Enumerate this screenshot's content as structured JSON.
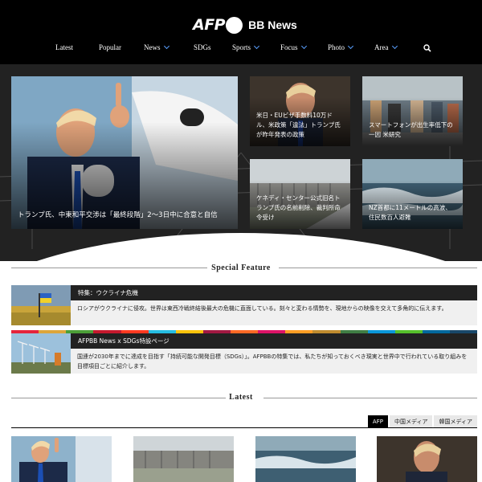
{
  "header": {
    "logo_afp": "AFP",
    "logo_bb": "BB News",
    "nav": [
      {
        "label": "Latest",
        "dropdown": false
      },
      {
        "label": "Popular",
        "dropdown": false
      },
      {
        "label": "News",
        "dropdown": true
      },
      {
        "label": "SDGs",
        "dropdown": false
      },
      {
        "label": "Sports",
        "dropdown": true
      },
      {
        "label": "Focus",
        "dropdown": true
      },
      {
        "label": "Photo",
        "dropdown": true
      },
      {
        "label": "Area",
        "dropdown": true
      }
    ],
    "search_icon": "search-icon"
  },
  "hero": {
    "main": {
      "caption": "トランプ氏、中東和平交渉は「最終段階」2～3日中に合意と自信"
    },
    "cards": [
      {
        "caption": "米日・EUビザ手数料10万ドル、米政策「違法」トランプ氏が昨年発表の政策"
      },
      {
        "caption": "スマートフォンが出生率低下の一因 米研究"
      },
      {
        "caption": "ケネディ・センター公式旧名トランプ氏の名前削除、裁判所命令受け"
      },
      {
        "caption": "NZ首都に11メートルの高波、住民数百人避難"
      }
    ]
  },
  "special": {
    "title": "Special Feature",
    "items": [
      {
        "title": "特集：ウクライナ危機",
        "desc": "ロシアがウクライナに侵攻。世界は東西冷戦終結後最大の危機に直面している。刻々と変わる情勢を、現地からの映像を交えて多角的に伝えます。"
      },
      {
        "title": "AFPBB News x SDGs特設ページ",
        "desc": "国連が2030年までに達成を目指す「持続可能な開発目標（SDGs）」。AFPBBの特集では、私たちが知っておくべき現実と世界中で行われている取り組みを目標項目ごとに紹介します。"
      }
    ]
  },
  "latest": {
    "title": "Latest",
    "tabs": [
      "AFP",
      "中国メディア",
      "韓国メディア"
    ],
    "active_tab": "AFP"
  },
  "colors": {
    "header_bg": "#000000",
    "accent_blue": "#5aa0ff",
    "feature_bar": "#222222"
  }
}
